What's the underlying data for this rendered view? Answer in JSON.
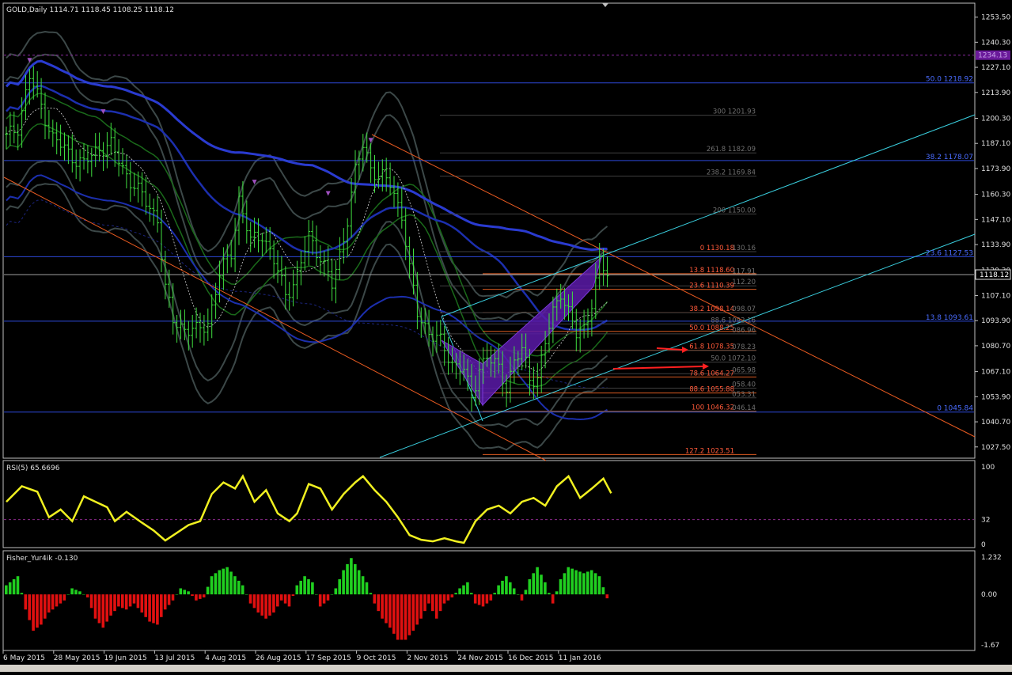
{
  "chart_data": {
    "type": "line",
    "symbol_header": "GOLD,Daily  1114.71 1118.45 1108.25 1118.12",
    "current_price": 1118.12,
    "current_price_label": "1118.12",
    "price_axis": {
      "ylim": [
        1022,
        1260
      ],
      "ticks": [
        "1253.50",
        "1240.30",
        "1227.10",
        "1213.90",
        "1200.30",
        "1187.10",
        "1173.90",
        "1160.30",
        "1147.10",
        "1133.90",
        "1120.30",
        "1107.10",
        "1093.90",
        "1080.70",
        "1067.10",
        "1053.90",
        "1040.70",
        "1027.50"
      ]
    },
    "time_axis": {
      "labels": [
        "6 May 2015",
        "28 May 2015",
        "19 Jun 2015",
        "13 Jul 2015",
        "4 Aug 2015",
        "26 Aug 2015",
        "17 Sep 2015",
        "9 Oct 2015",
        "2 Nov 2015",
        "24 Nov 2015",
        "16 Dec 2015",
        "11 Jan 2016"
      ]
    },
    "close_series": [
      {
        "x": 0,
        "y": 1190
      },
      {
        "x": 3,
        "y": 1196
      },
      {
        "x": 6,
        "y": 1222
      },
      {
        "x": 9,
        "y": 1207
      },
      {
        "x": 12,
        "y": 1190
      },
      {
        "x": 16,
        "y": 1182
      },
      {
        "x": 20,
        "y": 1176
      },
      {
        "x": 24,
        "y": 1185
      },
      {
        "x": 27,
        "y": 1186
      },
      {
        "x": 30,
        "y": 1174
      },
      {
        "x": 33,
        "y": 1165
      },
      {
        "x": 36,
        "y": 1156
      },
      {
        "x": 39,
        "y": 1148
      },
      {
        "x": 41,
        "y": 1110
      },
      {
        "x": 43,
        "y": 1094
      },
      {
        "x": 46,
        "y": 1090
      },
      {
        "x": 49,
        "y": 1088
      },
      {
        "x": 52,
        "y": 1093
      },
      {
        "x": 55,
        "y": 1118
      },
      {
        "x": 58,
        "y": 1130
      },
      {
        "x": 60,
        "y": 1158
      },
      {
        "x": 63,
        "y": 1135
      },
      {
        "x": 66,
        "y": 1140
      },
      {
        "x": 69,
        "y": 1125
      },
      {
        "x": 72,
        "y": 1108
      },
      {
        "x": 75,
        "y": 1117
      },
      {
        "x": 78,
        "y": 1138
      },
      {
        "x": 81,
        "y": 1128
      },
      {
        "x": 84,
        "y": 1112
      },
      {
        "x": 86,
        "y": 1128
      },
      {
        "x": 88,
        "y": 1148
      },
      {
        "x": 90,
        "y": 1172
      },
      {
        "x": 92,
        "y": 1186
      },
      {
        "x": 94,
        "y": 1175
      },
      {
        "x": 96,
        "y": 1170
      },
      {
        "x": 99,
        "y": 1166
      },
      {
        "x": 102,
        "y": 1150
      },
      {
        "x": 104,
        "y": 1120
      },
      {
        "x": 106,
        "y": 1098
      },
      {
        "x": 109,
        "y": 1088
      },
      {
        "x": 112,
        "y": 1082
      },
      {
        "x": 115,
        "y": 1072
      },
      {
        "x": 118,
        "y": 1068
      },
      {
        "x": 120,
        "y": 1052
      },
      {
        "x": 122,
        "y": 1070
      },
      {
        "x": 124,
        "y": 1075
      },
      {
        "x": 127,
        "y": 1068
      },
      {
        "x": 129,
        "y": 1060
      },
      {
        "x": 131,
        "y": 1072
      },
      {
        "x": 133,
        "y": 1078
      },
      {
        "x": 135,
        "y": 1064
      },
      {
        "x": 137,
        "y": 1064
      },
      {
        "x": 139,
        "y": 1082
      },
      {
        "x": 141,
        "y": 1098
      },
      {
        "x": 143,
        "y": 1110
      },
      {
        "x": 145,
        "y": 1098
      },
      {
        "x": 147,
        "y": 1086
      },
      {
        "x": 149,
        "y": 1090
      },
      {
        "x": 151,
        "y": 1104
      },
      {
        "x": 153,
        "y": 1124
      },
      {
        "x": 155,
        "y": 1118
      }
    ],
    "levels_right": [
      {
        "label": "50.0 1218.92",
        "value": 1218.92
      },
      {
        "label": "38.2 1178.07",
        "value": 1178.07
      },
      {
        "label": "23.6 1127.53",
        "value": 1127.53
      },
      {
        "label": "13.8 1093.61",
        "value": 1093.61
      },
      {
        "label": "0 1045.84",
        "value": 1045.84
      }
    ],
    "levels_red": [
      {
        "label": "0 1130.18",
        "value": 1130.18
      },
      {
        "label": "13.8 1118.60",
        "value": 1118.6
      },
      {
        "label": "23.6 1110.39",
        "value": 1110.39
      },
      {
        "label": "38.2 1098.14",
        "value": 1098.14
      },
      {
        "label": "50.0 1088.25",
        "value": 1088.25
      },
      {
        "label": "61.8 1078.35",
        "value": 1078.35
      },
      {
        "label": "78.6 1064.27",
        "value": 1064.27
      },
      {
        "label": "88.6 1055.88",
        "value": 1055.88
      },
      {
        "label": "100 1046.32",
        "value": 1046.32
      },
      {
        "label": "127.2 1023.51",
        "value": 1023.51
      }
    ],
    "levels_gray": [
      {
        "label": "300 1201.93",
        "value": 1201.93
      },
      {
        "label": "261.8 1182.09",
        "value": 1182.09
      },
      {
        "label": "238.2 1169.84",
        "value": 1169.84
      },
      {
        "label": "200 1150.00",
        "value": 1150.0
      },
      {
        "label": "130.16",
        "value": 1130.16
      },
      {
        "label": "117.91",
        "value": 1117.91
      },
      {
        "label": "112.20",
        "value": 1112.2
      },
      {
        "label": "098.07",
        "value": 1098.07
      },
      {
        "label": "88.6 1092.16",
        "value": 1092.16
      },
      {
        "label": "086.96",
        "value": 1086.96
      },
      {
        "label": "078.23",
        "value": 1078.23
      },
      {
        "label": "50.0 1072.10",
        "value": 1072.1
      },
      {
        "label": "065.98",
        "value": 1065.98
      },
      {
        "label": "058.40",
        "value": 1058.4
      },
      {
        "label": "053.31",
        "value": 1053.31
      },
      {
        "label": "046.14",
        "value": 1046.14
      }
    ],
    "box_label": "1234.13",
    "rsi": {
      "title": "RSI(5) 65.6696",
      "ylim": [
        0,
        100
      ],
      "axis_labels": [
        "100",
        "32",
        "0"
      ],
      "level": 32,
      "values": [
        {
          "x": 0,
          "y": 55
        },
        {
          "x": 4,
          "y": 75
        },
        {
          "x": 8,
          "y": 68
        },
        {
          "x": 11,
          "y": 35
        },
        {
          "x": 14,
          "y": 45
        },
        {
          "x": 17,
          "y": 30
        },
        {
          "x": 20,
          "y": 62
        },
        {
          "x": 23,
          "y": 55
        },
        {
          "x": 26,
          "y": 48
        },
        {
          "x": 28,
          "y": 30
        },
        {
          "x": 31,
          "y": 42
        },
        {
          "x": 35,
          "y": 28
        },
        {
          "x": 38,
          "y": 18
        },
        {
          "x": 41,
          "y": 5
        },
        {
          "x": 44,
          "y": 15
        },
        {
          "x": 47,
          "y": 25
        },
        {
          "x": 50,
          "y": 30
        },
        {
          "x": 53,
          "y": 65
        },
        {
          "x": 56,
          "y": 80
        },
        {
          "x": 59,
          "y": 72
        },
        {
          "x": 61,
          "y": 88
        },
        {
          "x": 64,
          "y": 55
        },
        {
          "x": 67,
          "y": 70
        },
        {
          "x": 70,
          "y": 40
        },
        {
          "x": 73,
          "y": 30
        },
        {
          "x": 75,
          "y": 40
        },
        {
          "x": 78,
          "y": 78
        },
        {
          "x": 81,
          "y": 72
        },
        {
          "x": 84,
          "y": 45
        },
        {
          "x": 87,
          "y": 65
        },
        {
          "x": 90,
          "y": 80
        },
        {
          "x": 92,
          "y": 88
        },
        {
          "x": 95,
          "y": 70
        },
        {
          "x": 98,
          "y": 55
        },
        {
          "x": 101,
          "y": 35
        },
        {
          "x": 104,
          "y": 12
        },
        {
          "x": 107,
          "y": 6
        },
        {
          "x": 110,
          "y": 4
        },
        {
          "x": 113,
          "y": 8
        },
        {
          "x": 116,
          "y": 4
        },
        {
          "x": 118,
          "y": 2
        },
        {
          "x": 121,
          "y": 30
        },
        {
          "x": 124,
          "y": 45
        },
        {
          "x": 127,
          "y": 50
        },
        {
          "x": 130,
          "y": 40
        },
        {
          "x": 133,
          "y": 55
        },
        {
          "x": 136,
          "y": 60
        },
        {
          "x": 139,
          "y": 50
        },
        {
          "x": 142,
          "y": 75
        },
        {
          "x": 145,
          "y": 88
        },
        {
          "x": 148,
          "y": 60
        },
        {
          "x": 151,
          "y": 72
        },
        {
          "x": 154,
          "y": 85
        },
        {
          "x": 156,
          "y": 66
        }
      ]
    },
    "fisher": {
      "title": "Fisher_Yur4ik -0.130",
      "ylim": [
        -1.67,
        1.232
      ],
      "axis_labels": [
        "1.232",
        "0.00",
        "-1.67"
      ],
      "values": [
        {
          "x": 0,
          "y": 0.3
        },
        {
          "x": 3,
          "y": 0.6
        },
        {
          "x": 5,
          "y": -0.5
        },
        {
          "x": 7,
          "y": -1.2
        },
        {
          "x": 9,
          "y": -1.0
        },
        {
          "x": 11,
          "y": -0.6
        },
        {
          "x": 13,
          "y": -0.4
        },
        {
          "x": 15,
          "y": -0.2
        },
        {
          "x": 17,
          "y": 0.2
        },
        {
          "x": 19,
          "y": 0.1
        },
        {
          "x": 21,
          "y": -0.1
        },
        {
          "x": 23,
          "y": -0.8
        },
        {
          "x": 25,
          "y": -1.1
        },
        {
          "x": 27,
          "y": -0.7
        },
        {
          "x": 29,
          "y": -0.4
        },
        {
          "x": 31,
          "y": -0.5
        },
        {
          "x": 33,
          "y": -0.3
        },
        {
          "x": 35,
          "y": -0.6
        },
        {
          "x": 37,
          "y": -0.9
        },
        {
          "x": 39,
          "y": -1.0
        },
        {
          "x": 41,
          "y": -0.5
        },
        {
          "x": 43,
          "y": -0.2
        },
        {
          "x": 45,
          "y": 0.2
        },
        {
          "x": 47,
          "y": 0.1
        },
        {
          "x": 49,
          "y": -0.2
        },
        {
          "x": 51,
          "y": -0.1
        },
        {
          "x": 53,
          "y": 0.6
        },
        {
          "x": 55,
          "y": 0.8
        },
        {
          "x": 57,
          "y": 0.9
        },
        {
          "x": 59,
          "y": 0.6
        },
        {
          "x": 61,
          "y": 0.3
        },
        {
          "x": 63,
          "y": -0.3
        },
        {
          "x": 65,
          "y": -0.6
        },
        {
          "x": 67,
          "y": -0.8
        },
        {
          "x": 69,
          "y": -0.6
        },
        {
          "x": 71,
          "y": -0.2
        },
        {
          "x": 73,
          "y": -0.4
        },
        {
          "x": 75,
          "y": 0.3
        },
        {
          "x": 77,
          "y": 0.6
        },
        {
          "x": 79,
          "y": 0.4
        },
        {
          "x": 81,
          "y": -0.4
        },
        {
          "x": 83,
          "y": -0.2
        },
        {
          "x": 85,
          "y": 0.2
        },
        {
          "x": 87,
          "y": 0.8
        },
        {
          "x": 89,
          "y": 1.2
        },
        {
          "x": 91,
          "y": 0.8
        },
        {
          "x": 93,
          "y": 0.4
        },
        {
          "x": 95,
          "y": -0.3
        },
        {
          "x": 97,
          "y": -0.8
        },
        {
          "x": 99,
          "y": -1.1
        },
        {
          "x": 101,
          "y": -1.5
        },
        {
          "x": 103,
          "y": -1.5
        },
        {
          "x": 105,
          "y": -1.2
        },
        {
          "x": 107,
          "y": -0.8
        },
        {
          "x": 109,
          "y": -0.3
        },
        {
          "x": 111,
          "y": -0.8
        },
        {
          "x": 113,
          "y": -0.3
        },
        {
          "x": 115,
          "y": -0.1
        },
        {
          "x": 117,
          "y": 0.2
        },
        {
          "x": 119,
          "y": 0.4
        },
        {
          "x": 121,
          "y": -0.3
        },
        {
          "x": 123,
          "y": -0.4
        },
        {
          "x": 125,
          "y": -0.2
        },
        {
          "x": 127,
          "y": 0.3
        },
        {
          "x": 129,
          "y": 0.6
        },
        {
          "x": 131,
          "y": 0.2
        },
        {
          "x": 133,
          "y": -0.2
        },
        {
          "x": 135,
          "y": 0.5
        },
        {
          "x": 137,
          "y": 0.9
        },
        {
          "x": 139,
          "y": 0.4
        },
        {
          "x": 141,
          "y": -0.3
        },
        {
          "x": 143,
          "y": 0.5
        },
        {
          "x": 145,
          "y": 0.9
        },
        {
          "x": 147,
          "y": 0.8
        },
        {
          "x": 149,
          "y": 0.7
        },
        {
          "x": 151,
          "y": 0.8
        },
        {
          "x": 153,
          "y": 0.6
        },
        {
          "x": 155,
          "y": -0.13
        }
      ]
    }
  }
}
